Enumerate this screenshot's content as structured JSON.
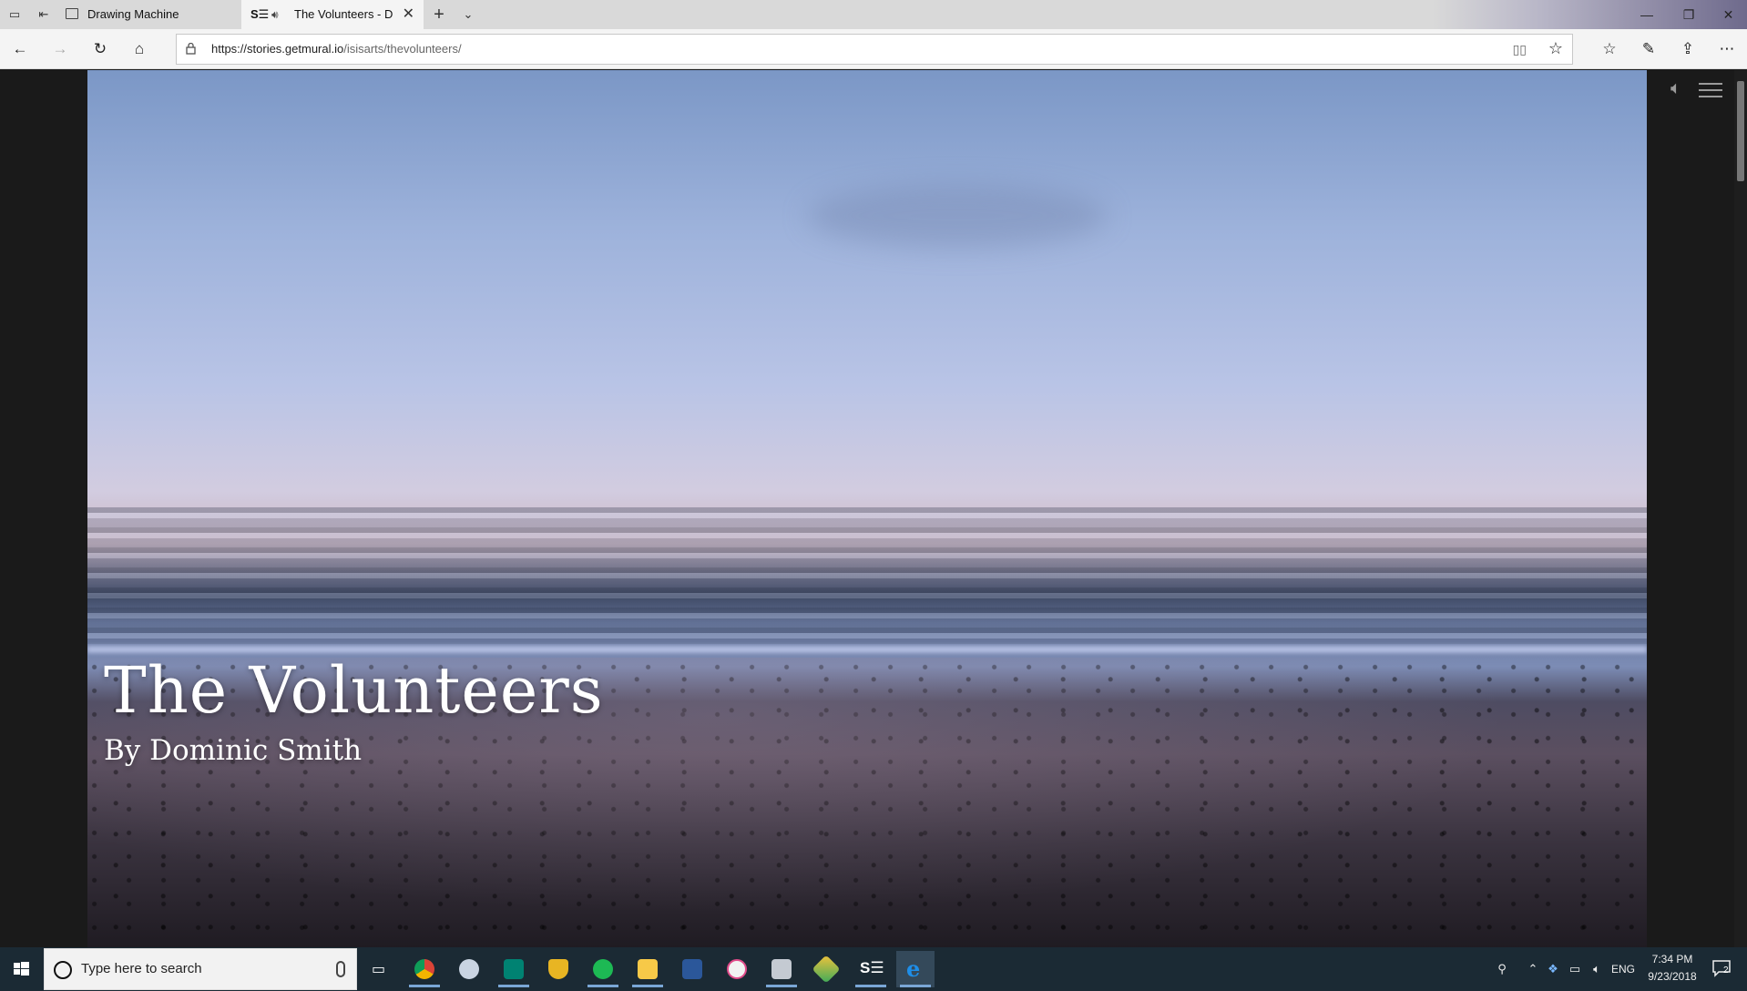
{
  "browser": {
    "tabs": [
      {
        "label": "Drawing Machine",
        "active": false
      },
      {
        "label": "The Volunteers - D",
        "active": true,
        "audio": true
      }
    ],
    "address_bar": {
      "url_host": "https://stories.getmural.io",
      "url_path": "/isisarts/thevolunteers/"
    }
  },
  "story": {
    "title": "The Volunteers",
    "byline": "By Dominic Smith"
  },
  "taskbar": {
    "search_placeholder": "Type here to search",
    "apps": [
      "chrome-icon",
      "game-controller-icon",
      "sway-icon",
      "shield-icon",
      "spotify-icon",
      "file-explorer-icon",
      "word-icon",
      "itunes-icon",
      "photos-icon",
      "git-icon",
      "sway-icon",
      "edge-icon"
    ],
    "language": "ENG",
    "time": "7:34 PM",
    "date": "9/23/2018",
    "notification_count": "2"
  }
}
